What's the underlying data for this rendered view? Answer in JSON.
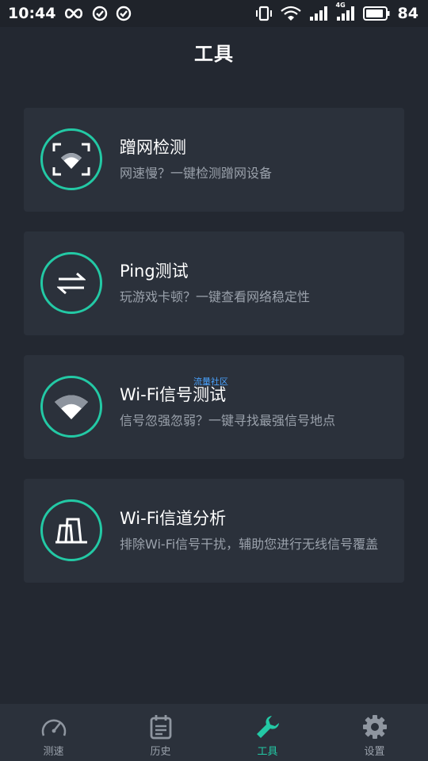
{
  "status_bar": {
    "time": "10:44",
    "battery_percent": "84",
    "network_label": "4G",
    "icons": [
      "infinity-icon",
      "check-circle-icon",
      "check-circle-icon",
      "vibrate-icon",
      "wifi-icon",
      "signal-icon",
      "signal-4g-icon",
      "battery-icon"
    ]
  },
  "header": {
    "title": "工具"
  },
  "tools": [
    {
      "icon": "wifi-scan-icon",
      "title": "蹭网检测",
      "desc": "网速慢？一键检测蹭网设备"
    },
    {
      "icon": "swap-arrows-icon",
      "title": "Ping测试",
      "desc": "玩游戏卡顿？一键查看网络稳定性"
    },
    {
      "icon": "wifi-signal-icon",
      "title": "Wi-Fi信号测试",
      "desc": "信号忽强忽弱？一键寻找最强信号地点"
    },
    {
      "icon": "channel-analysis-icon",
      "title": "Wi-Fi信道分析",
      "desc": "排除Wi-Fi信号干扰，辅助您进行无线信号覆盖"
    }
  ],
  "watermark": "流量社区",
  "bottom_nav": [
    {
      "icon": "speedometer-icon",
      "label": "测速",
      "active": false
    },
    {
      "icon": "calendar-icon",
      "label": "历史",
      "active": false
    },
    {
      "icon": "wrench-icon",
      "label": "工具",
      "active": true
    },
    {
      "icon": "gear-icon",
      "label": "设置",
      "active": false
    }
  ],
  "colors": {
    "background": "#232831",
    "card": "#2b313b",
    "accent": "#23c9a5",
    "muted_text": "#9aa1ab"
  }
}
